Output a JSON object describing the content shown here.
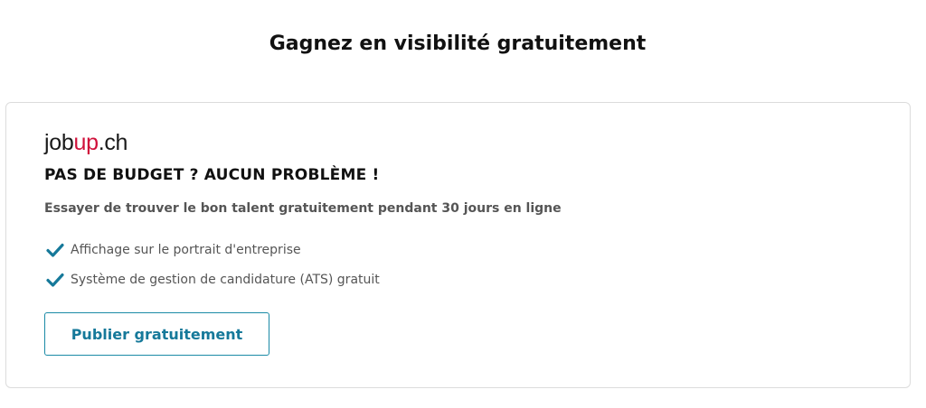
{
  "page": {
    "title": "Gagnez en visibilité gratuitement"
  },
  "card": {
    "logo": {
      "part1": "job",
      "part2": "up",
      "part3": ".ch",
      "accent_color": "#d0103a"
    },
    "headline": "PAS DE BUDGET ? AUCUN PROBLÈME !",
    "subline": "Essayer de trouver le bon talent gratuitement pendant 30 jours en ligne",
    "features": [
      {
        "icon": "check-icon",
        "label": "Affichage sur le portrait d'entreprise"
      },
      {
        "icon": "check-icon",
        "label": "Système de gestion de candidature (ATS) gratuit"
      }
    ],
    "cta_label": "Publier gratuitement",
    "accent_color": "#16799a"
  }
}
